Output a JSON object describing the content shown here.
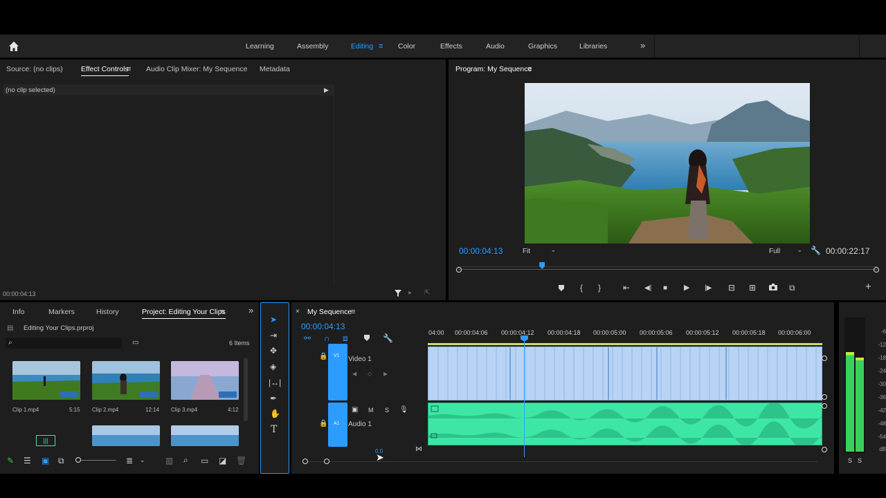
{
  "workspaces": {
    "items": [
      "Learning",
      "Assembly",
      "Editing",
      "Color",
      "Effects",
      "Audio",
      "Graphics",
      "Libraries"
    ],
    "active": "Editing"
  },
  "source_panel": {
    "tabs": [
      "Source: (no clips)",
      "Effect Controls",
      "Audio Clip Mixer: My Sequence",
      "Metadata"
    ],
    "active_tab": "Effect Controls",
    "no_clip_text": "(no clip selected)",
    "timecode": "00:00:04:13"
  },
  "program_monitor": {
    "title": "Program: My Sequence",
    "current_timecode": "00:00:04:13",
    "fit_label": "Fit",
    "quality_label": "Full",
    "duration": "00:00:22:17",
    "playhead_fraction": 0.2
  },
  "project_panel": {
    "tabs": [
      "Info",
      "Markers",
      "History",
      "Project: Editing Your Clips"
    ],
    "active_tab": "Project: Editing Your Clips",
    "project_file": "Editing Your Clips.prproj",
    "item_count": "6 Items",
    "clips": [
      {
        "name": "Clip 1.mp4",
        "duration": "5:15"
      },
      {
        "name": "Clip 2.mp4",
        "duration": "12:14"
      },
      {
        "name": "Clip 3.mp4",
        "duration": "4:12"
      }
    ]
  },
  "timeline": {
    "sequence_name": "My Sequence",
    "timecode": "00:00:04:13",
    "ruler_labels": [
      "04:00",
      "00:00:04:06",
      "00:00:04:12",
      "00:00:04:18",
      "00:00:05:00",
      "00:00:05:06",
      "00:00:05:12",
      "00:00:05:18",
      "00:00:06:00"
    ],
    "video_track": {
      "id": "V1",
      "name": "Video 1"
    },
    "audio_track": {
      "id": "A1",
      "name": "Audio 1",
      "m": "M",
      "s": "S"
    },
    "zoom_value": "0.0"
  },
  "audio_meter": {
    "scale": [
      "-6",
      "-12",
      "-18",
      "-24",
      "-30",
      "-36",
      "-42",
      "-48",
      "-54",
      "dB"
    ],
    "solo_labels": [
      "S",
      "S"
    ]
  },
  "colors": {
    "accent": "#2d9cff",
    "video_clip": "#b9d3f5",
    "audio_clip": "#3ee6a6",
    "track_header": "#2d9cff"
  }
}
